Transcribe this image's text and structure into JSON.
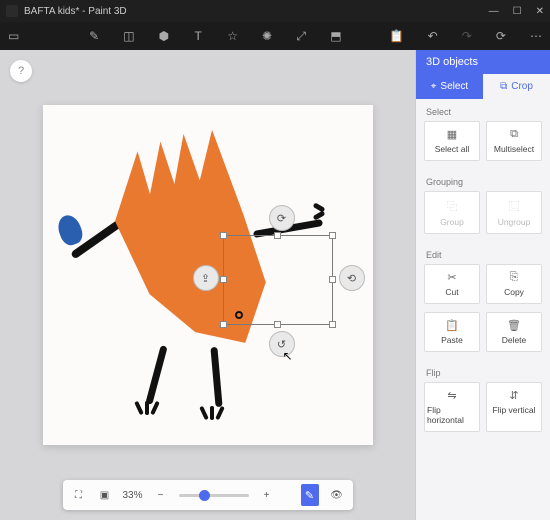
{
  "window": {
    "title": "BAFTA kids* - Paint 3D"
  },
  "panel": {
    "title": "3D objects",
    "modes": {
      "select": "Select",
      "crop": "Crop"
    },
    "sections": {
      "select": "Select",
      "grouping": "Grouping",
      "edit": "Edit",
      "flip": "Flip"
    },
    "buttons": {
      "select_all": "Select all",
      "multiselect": "Multiselect",
      "group": "Group",
      "ungroup": "Ungroup",
      "cut": "Cut",
      "copy": "Copy",
      "paste": "Paste",
      "delete": "Delete",
      "flip_h": "Flip horizontal",
      "flip_v": "Flip vertical"
    }
  },
  "zoom": {
    "value": "33%",
    "minus": "−",
    "plus": "+"
  },
  "help": "?"
}
